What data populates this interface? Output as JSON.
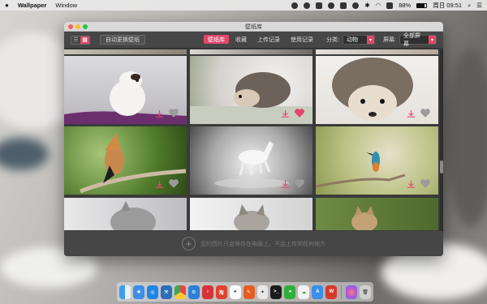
{
  "menubar": {
    "app_name": "Wallpaper",
    "menu_window": "Window",
    "battery": "88%",
    "clock": "周日 09:51"
  },
  "window": {
    "title": "壁纸库",
    "toolbar": {
      "auto_change_label": "自动更换壁纸",
      "tabs": [
        {
          "label": "壁纸库",
          "active": true
        },
        {
          "label": "收藏",
          "active": false
        },
        {
          "label": "上传记录",
          "active": false
        },
        {
          "label": "使用记录",
          "active": false
        }
      ],
      "category_label": "分类:",
      "category_value": "动物",
      "screen_label": "屏幕:",
      "screen_value": "全部屏幕"
    },
    "footer_text": "您的图片只会保存在电脑上，不会上传到任何地方"
  },
  "colors": {
    "accent": "#e2466d",
    "window_bg": "#3b3b3b"
  },
  "grid_tiles": [
    {
      "subject": "guinea-pig",
      "favorited": false
    },
    {
      "subject": "hedgehog-in-grass",
      "favorited": true
    },
    {
      "subject": "hedgehog-closeup",
      "favorited": false
    },
    {
      "subject": "hoopoe-bird",
      "favorited": false
    },
    {
      "subject": "white-horse-in-mist",
      "favorited": false
    },
    {
      "subject": "kingfisher",
      "favorited": false
    }
  ]
}
